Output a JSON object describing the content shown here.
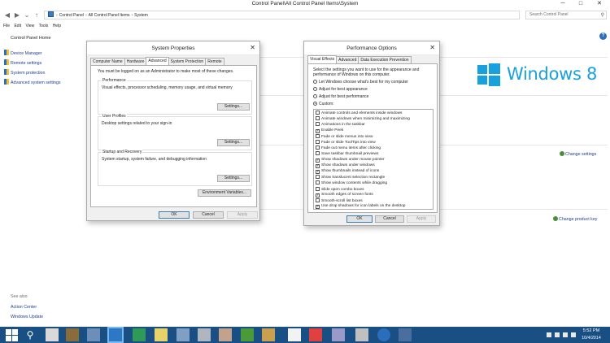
{
  "window": {
    "title": "Control Panel\\All Control Panel Items\\System",
    "minimize_glyph": "─",
    "maximize_glyph": "□",
    "close_glyph": "✕"
  },
  "nav": {
    "back": "◀",
    "forward": "▶",
    "down": "⌄",
    "up": "↑"
  },
  "address": {
    "crumbs": [
      "Control Panel",
      "All Control Panel Items",
      "System"
    ],
    "separator": "›"
  },
  "search": {
    "placeholder": "Search Control Panel"
  },
  "menu": [
    "File",
    "Edit",
    "View",
    "Tools",
    "Help"
  ],
  "help_glyph": "?",
  "left": {
    "home": "Control Panel Home",
    "links": [
      "Device Manager",
      "Remote settings",
      "System protection",
      "Advanced system settings"
    ],
    "see_also": "See also",
    "see_also_links": [
      "Action Center",
      "Windows Update"
    ]
  },
  "brand": {
    "text": "Windows",
    "version": "8",
    "color": "#18a1dd"
  },
  "right_links": {
    "change_settings": "Change settings",
    "change_key": "Change product key"
  },
  "system_properties": {
    "title": "System Properties",
    "tabs": [
      "Computer Name",
      "Hardware",
      "Advanced",
      "System Protection",
      "Remote"
    ],
    "active_tab": "Advanced",
    "intro": "You must be logged on as an Administrator to make most of these changes.",
    "groups": [
      {
        "title": "Performance",
        "text": "Visual effects, processor scheduling, memory usage, and virtual memory",
        "button": "Settings..."
      },
      {
        "title": "User Profiles",
        "text": "Desktop settings related to your sign-in",
        "button": "Settings..."
      },
      {
        "title": "Startup and Recovery",
        "text": "System startup, system failure, and debugging information",
        "button": "Settings..."
      }
    ],
    "env_button": "Environment Variables...",
    "ok": "OK",
    "cancel": "Cancel",
    "apply": "Apply"
  },
  "performance_options": {
    "title": "Performance Options",
    "tabs": [
      "Visual Effects",
      "Advanced",
      "Data Execution Prevention"
    ],
    "active_tab": "Visual Effects",
    "intro": "Select the settings you want to use for the appearance and performance of Windows on this computer.",
    "radios": [
      {
        "label": "Let Windows choose what's best for my computer",
        "selected": false
      },
      {
        "label": "Adjust for best appearance",
        "selected": false
      },
      {
        "label": "Adjust for best performance",
        "selected": false
      },
      {
        "label": "Custom:",
        "selected": true
      }
    ],
    "checkboxes": [
      {
        "label": "Animate controls and elements inside windows",
        "checked": false
      },
      {
        "label": "Animate windows when minimizing and maximizing",
        "checked": false
      },
      {
        "label": "Animations in the taskbar",
        "checked": false
      },
      {
        "label": "Enable Peek",
        "checked": true
      },
      {
        "label": "Fade or slide menus into view",
        "checked": false
      },
      {
        "label": "Fade or slide ToolTips into view",
        "checked": false
      },
      {
        "label": "Fade out menu items after clicking",
        "checked": false
      },
      {
        "label": "Save taskbar thumbnail previews",
        "checked": false
      },
      {
        "label": "Show shadows under mouse pointer",
        "checked": true
      },
      {
        "label": "Show shadows under windows",
        "checked": true
      },
      {
        "label": "Show thumbnails instead of icons",
        "checked": true
      },
      {
        "label": "Show translucent selection rectangle",
        "checked": false
      },
      {
        "label": "Show window contents while dragging",
        "checked": false
      },
      {
        "label": "Slide open combo boxes",
        "checked": false
      },
      {
        "label": "Smooth edges of screen fonts",
        "checked": true
      },
      {
        "label": "Smooth-scroll list boxes",
        "checked": false
      },
      {
        "label": "Use drop shadows for icon labels on the desktop",
        "checked": true
      }
    ],
    "check_glyph": "✓",
    "ok": "OK",
    "cancel": "Cancel",
    "apply": "Apply"
  },
  "taskbar": {
    "time": "5:52 PM",
    "date": "10/4/2014",
    "search_glyph": "⚲",
    "colors": {
      "bar": "#1a4f84"
    }
  }
}
